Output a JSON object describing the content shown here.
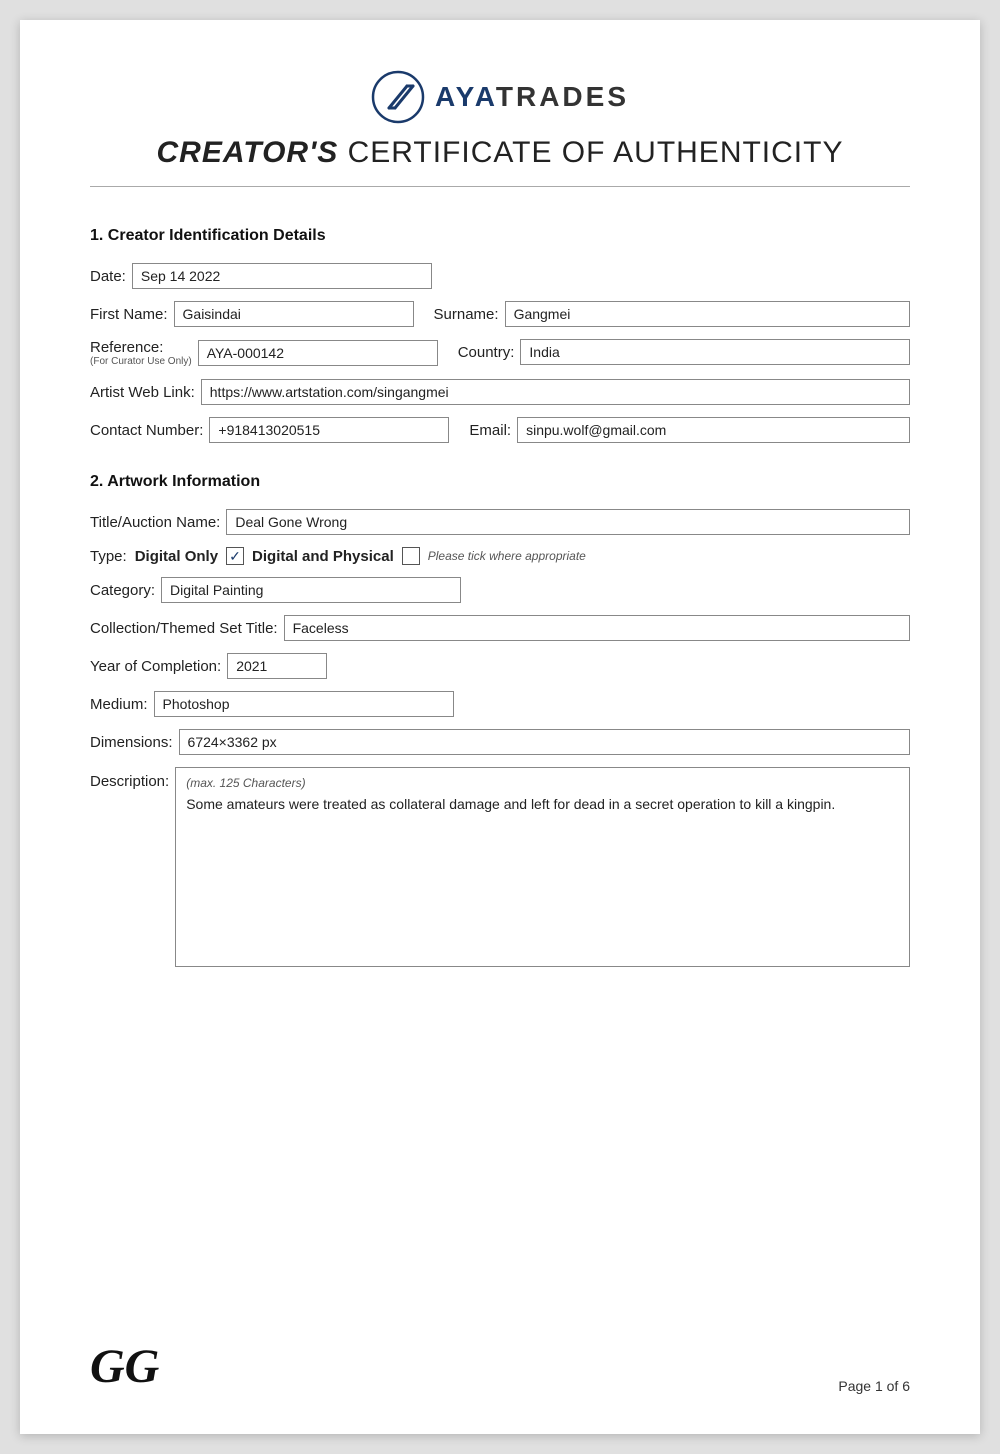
{
  "header": {
    "logo_text": "AYATRADES",
    "logo_aya": "AYA",
    "logo_trades": "TRADES",
    "cert_title_bold": "CREATOR'S",
    "cert_title_rest": " CERTIFICATE OF AUTHENTICITY"
  },
  "section1": {
    "heading": "1. Creator Identification Details",
    "date_label": "Date:",
    "date_value": "Sep 14 2022",
    "first_name_label": "First Name:",
    "first_name_value": "Gaisindai",
    "surname_label": "Surname:",
    "surname_value": "Gangmei",
    "reference_label": "Reference:",
    "reference_sublabel": "(For Curator Use Only)",
    "reference_value": "AYA-000142",
    "country_label": "Country:",
    "country_value": "India",
    "web_label": "Artist Web Link:",
    "web_value": "https://www.artstation.com/singangmei",
    "contact_label": "Contact Number:",
    "contact_value": "+918413020515",
    "email_label": "Email:",
    "email_value": "sinpu.wolf@gmail.com"
  },
  "section2": {
    "heading": "2. Artwork Information",
    "title_label": "Title/Auction Name:",
    "title_value": "Deal Gone Wrong",
    "type_label": "Type:",
    "type_digital_only": "Digital Only",
    "type_checkbox1_checked": true,
    "type_digital_physical": "Digital and Physical",
    "type_checkbox2_checked": false,
    "type_hint": "Please tick where appropriate",
    "category_label": "Category:",
    "category_value": "Digital Painting",
    "collection_label": "Collection/Themed Set Title:",
    "collection_value": "Faceless",
    "year_label": "Year of Completion:",
    "year_value": "2021",
    "medium_label": "Medium:",
    "medium_value": "Photoshop",
    "dimensions_label": "Dimensions:",
    "dimensions_value": "6724×3362 px",
    "description_label": "Description:",
    "description_hint": "(max. 125 Characters)",
    "description_value": "Some amateurs were treated as collateral damage and left for dead in a secret operation to kill a kingpin."
  },
  "footer": {
    "signature": "GG",
    "page_text": "Page 1 of 6"
  }
}
